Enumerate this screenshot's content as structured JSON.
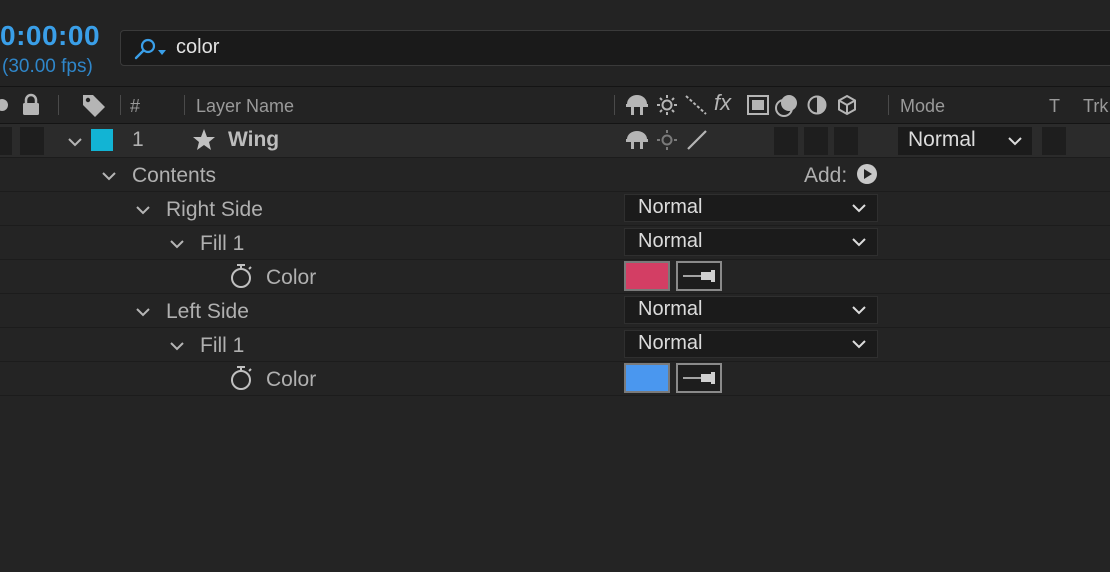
{
  "timecode": "0:00:00",
  "fps": "(30.00 fps)",
  "search": {
    "value": "color"
  },
  "header": {
    "number": "#",
    "layer_name": "Layer Name",
    "mode": "Mode",
    "t": "T",
    "trkmat": "Trk"
  },
  "layer": {
    "number": "1",
    "name": "Wing",
    "label_color": "#12b4d4",
    "mode": "Normal"
  },
  "contents": {
    "label": "Contents",
    "add_label": "Add:"
  },
  "groups": [
    {
      "name": "Right Side",
      "blend": "Normal",
      "fill": {
        "name": "Fill 1",
        "blend": "Normal",
        "color_label": "Color",
        "color": "#d33e64"
      }
    },
    {
      "name": "Left Side",
      "blend": "Normal",
      "fill": {
        "name": "Fill 1",
        "blend": "Normal",
        "color_label": "Color",
        "color": "#4a97ef"
      }
    }
  ]
}
